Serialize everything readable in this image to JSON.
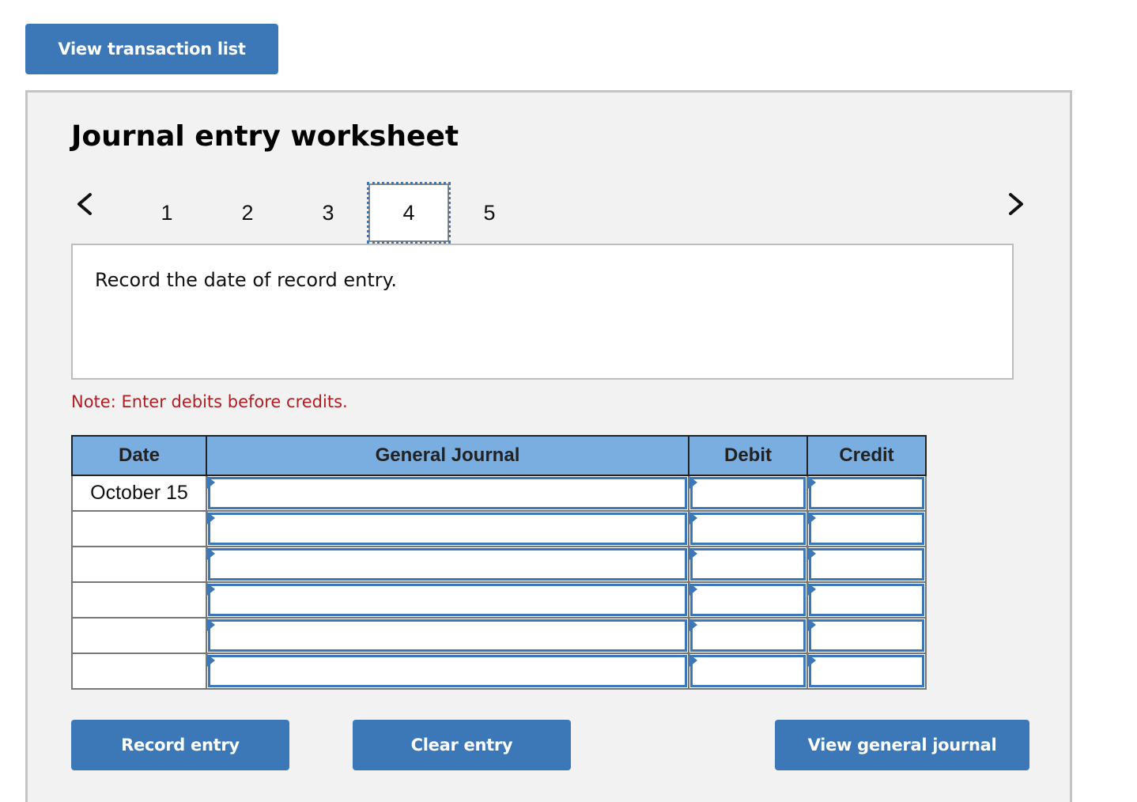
{
  "header": {
    "view_transaction_list": "View transaction list"
  },
  "worksheet": {
    "title": "Journal entry worksheet",
    "nav": {
      "prev_icon": "chevron-left-icon",
      "next_icon": "chevron-right-icon",
      "pages": [
        "1",
        "2",
        "3",
        "4",
        "5"
      ],
      "active_page": "4"
    },
    "prompt": "Record the date of record entry.",
    "note": "Note: Enter debits before credits.",
    "colors": {
      "accent": "#3c78b8",
      "header_bg": "#7aade0",
      "note": "#b01e24",
      "panel_bg": "#f2f2f2"
    }
  },
  "table": {
    "headers": {
      "date": "Date",
      "general_journal": "General Journal",
      "debit": "Debit",
      "credit": "Credit"
    },
    "rows": [
      {
        "date": "October 15",
        "account": "",
        "debit": "",
        "credit": ""
      },
      {
        "date": "",
        "account": "",
        "debit": "",
        "credit": ""
      },
      {
        "date": "",
        "account": "",
        "debit": "",
        "credit": ""
      },
      {
        "date": "",
        "account": "",
        "debit": "",
        "credit": ""
      },
      {
        "date": "",
        "account": "",
        "debit": "",
        "credit": ""
      },
      {
        "date": "",
        "account": "",
        "debit": "",
        "credit": ""
      }
    ]
  },
  "buttons": {
    "record_entry": "Record entry",
    "clear_entry": "Clear entry",
    "view_general_journal": "View general journal"
  }
}
